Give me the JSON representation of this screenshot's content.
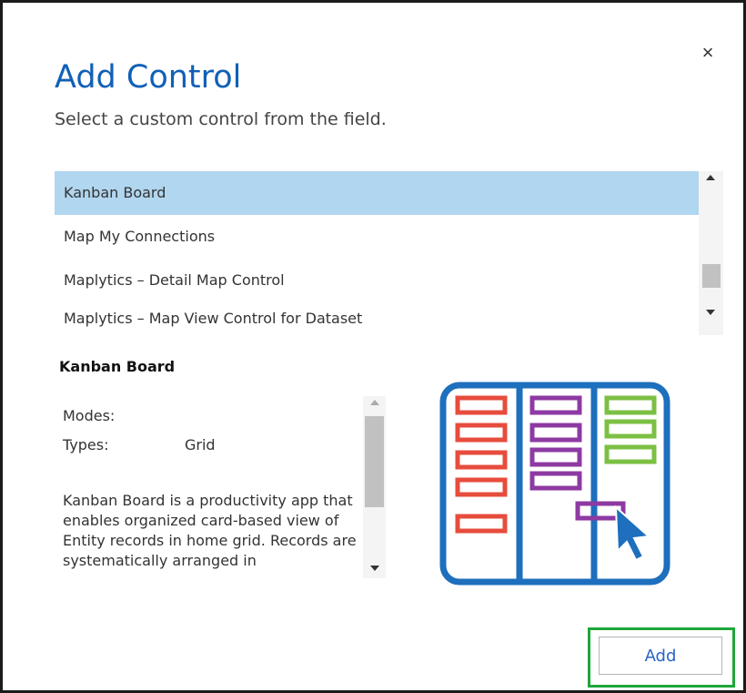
{
  "dialog": {
    "close_glyph": "×",
    "title": "Add Control",
    "subtitle": "Select a custom control from the field."
  },
  "list": {
    "items": [
      {
        "label": "Kanban Board",
        "selected": true
      },
      {
        "label": "Map My Connections",
        "selected": false
      },
      {
        "label": "Maplytics – Detail Map Control",
        "selected": false
      },
      {
        "label": "Maplytics – Map View Control for Dataset",
        "selected": false
      }
    ]
  },
  "detail": {
    "title": "Kanban Board",
    "modes_label": "Modes:",
    "types_label": "Types:",
    "types_value": "Grid",
    "description": "Kanban Board is a productivity app that enables organized card-based view of Entity records in home grid. Records are systematically arranged in"
  },
  "footer": {
    "add_label": "Add"
  },
  "colors": {
    "title_blue": "#1160b7",
    "selected_row": "#b1d6f0",
    "highlight_green": "#1fa63a",
    "board_blue": "#1e6fbd",
    "card_red": "#e74c3c",
    "card_purple": "#8e3aa3",
    "card_green": "#7cc043"
  },
  "icons": {
    "close": "close-icon",
    "preview": "kanban-board-icon"
  }
}
